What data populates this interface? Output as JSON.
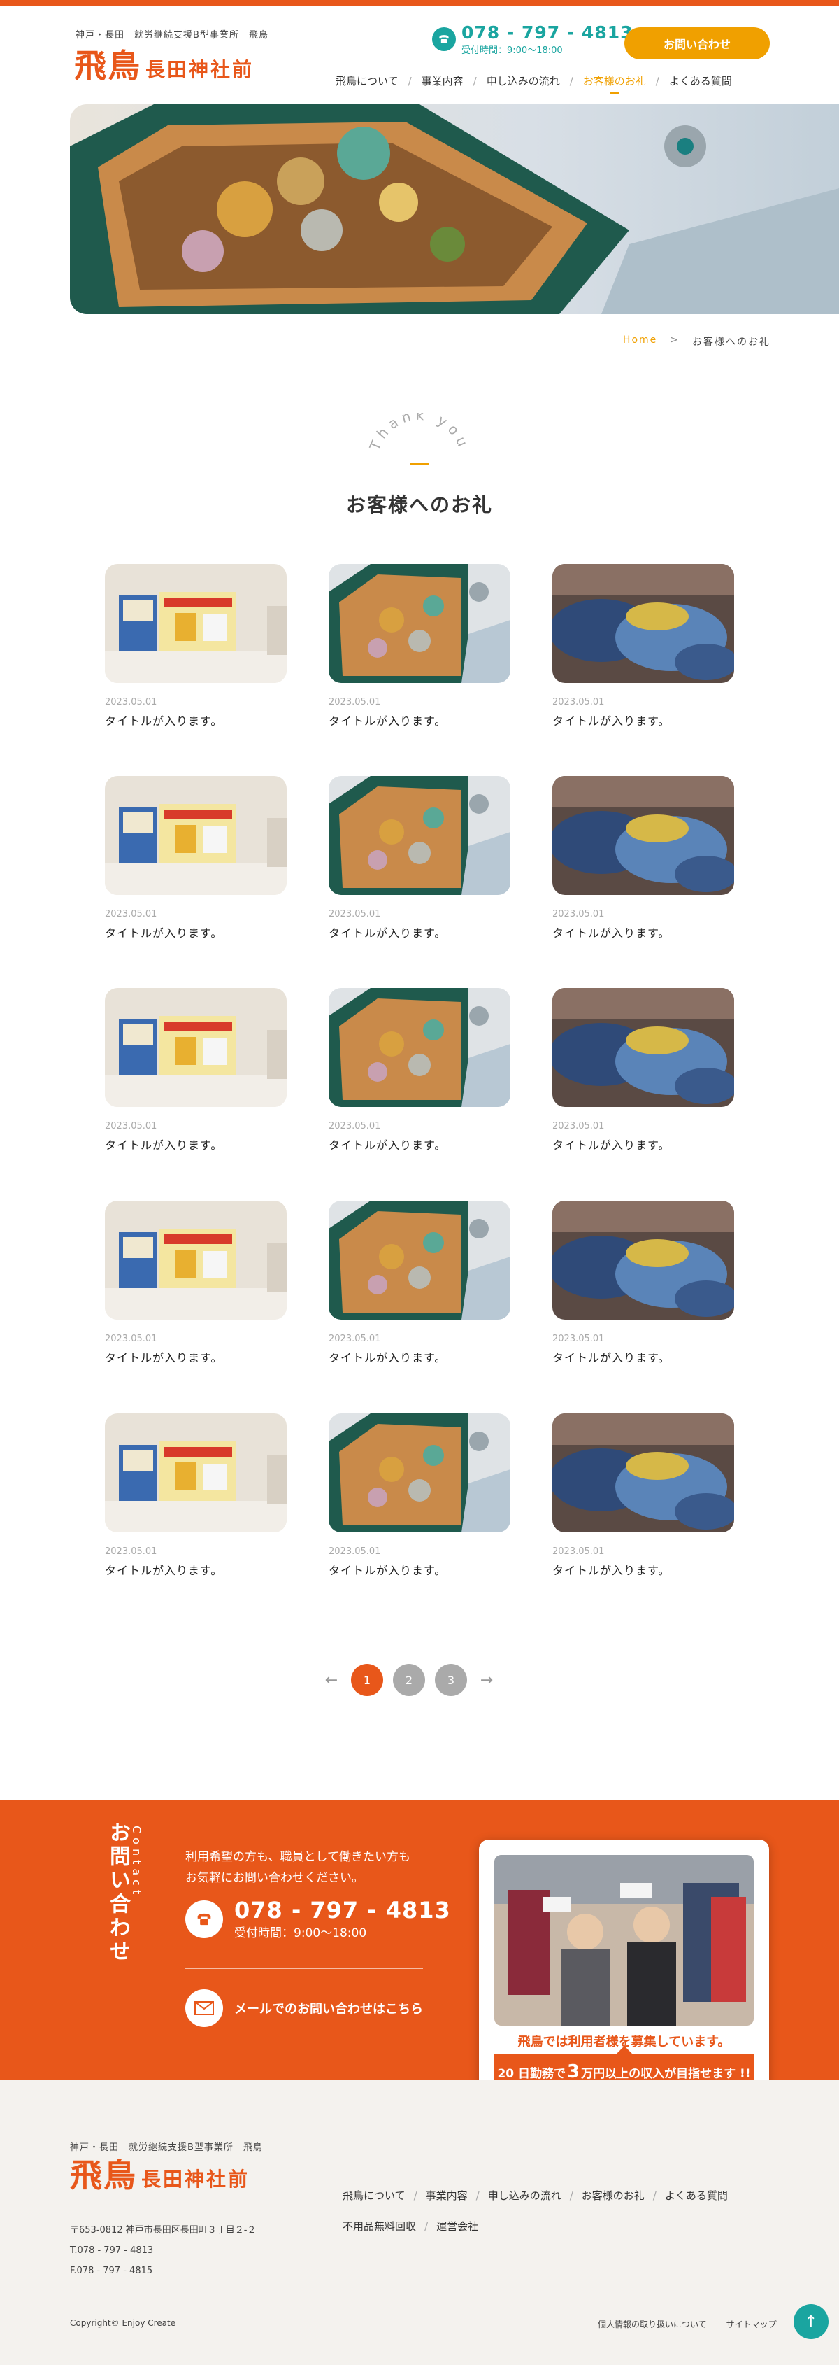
{
  "header": {
    "sub": "神戸・長田　就労継続支援B型事業所　飛鳥",
    "logo_main": "飛鳥",
    "logo_sub": "長田神社前",
    "tel": "078 - 797 - 4813",
    "hours": "受付時間：9:00〜18:00",
    "contact_button": "お問い合わせ"
  },
  "nav": [
    "飛鳥について",
    "事業内容",
    "申し込みの流れ",
    "お客様のお礼",
    "よくある質問"
  ],
  "breadcrumb": {
    "home": "Home",
    "sep": ">",
    "current": "お客様へのお礼"
  },
  "title": {
    "en": "Thank you",
    "jp": "お客様へのお礼"
  },
  "cards": [
    {
      "date": "2023.05.01",
      "title": "タイトルが入ります。"
    },
    {
      "date": "2023.05.01",
      "title": "タイトルが入ります。"
    },
    {
      "date": "2023.05.01",
      "title": "タイトルが入ります。"
    },
    {
      "date": "2023.05.01",
      "title": "タイトルが入ります。"
    },
    {
      "date": "2023.05.01",
      "title": "タイトルが入ります。"
    },
    {
      "date": "2023.05.01",
      "title": "タイトルが入ります。"
    },
    {
      "date": "2023.05.01",
      "title": "タイトルが入ります。"
    },
    {
      "date": "2023.05.01",
      "title": "タイトルが入ります。"
    },
    {
      "date": "2023.05.01",
      "title": "タイトルが入ります。"
    },
    {
      "date": "2023.05.01",
      "title": "タイトルが入ります。"
    },
    {
      "date": "2023.05.01",
      "title": "タイトルが入ります。"
    },
    {
      "date": "2023.05.01",
      "title": "タイトルが入ります。"
    },
    {
      "date": "2023.05.01",
      "title": "タイトルが入ります。"
    },
    {
      "date": "2023.05.01",
      "title": "タイトルが入ります。"
    },
    {
      "date": "2023.05.01",
      "title": "タイトルが入ります。"
    }
  ],
  "pagination": {
    "prev": "←",
    "pages": [
      "1",
      "2",
      "3"
    ],
    "next": "→",
    "current": "1"
  },
  "contact": {
    "title": "お問い合わせ",
    "en": "Contact",
    "lead1": "利用希望の方も、職員として働きたい方も",
    "lead2": "お気軽にお問い合わせください。",
    "tel": "078 - 797 - 4813",
    "hours": "受付時間：9:00〜18:00",
    "mail": "メールでのお問い合わせはこちら",
    "recruit_text": "飛鳥では利用者様を募集しています。",
    "recruit_box_pre": "20 日勤務で",
    "recruit_box_num": "3",
    "recruit_box_post": "万円以上の収入が目指せます !!"
  },
  "footer": {
    "sub": "神戸・長田　就労継続支援B型事業所　飛鳥",
    "logo_main": "飛鳥",
    "logo_sub": "長田神社前",
    "address": "〒653-0812 神戸市長田区長田町３丁目２-２",
    "tel": "T.078 - 797 - 4813",
    "fax": "F.078 - 797 - 4815",
    "nav": [
      "飛鳥について",
      "事業内容",
      "申し込みの流れ",
      "お客様のお礼",
      "よくある質問",
      "不用品無料回収",
      "運営会社"
    ],
    "copyright": "Copyright© Enjoy Create",
    "privacy": "個人情報の取り扱いについて",
    "sitemap": "サイトマップ"
  },
  "colors": {
    "accent": "#e8571a",
    "orange": "#f0a000",
    "teal": "#1aa5a0"
  }
}
